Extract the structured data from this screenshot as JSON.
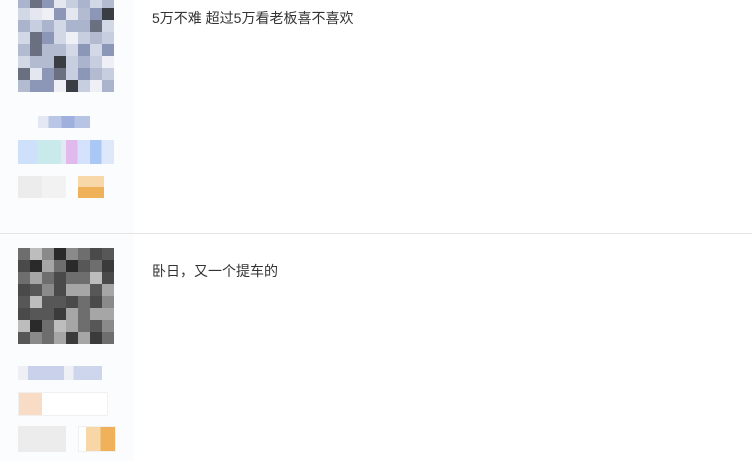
{
  "posts": [
    {
      "content": "5万不难 超过5万看老板喜不喜欢"
    },
    {
      "content": "卧日，又一个提车的"
    }
  ],
  "colors": {
    "divider": "#e5e5e5",
    "author_bg": "#fbfcfe",
    "text": "#333333"
  }
}
